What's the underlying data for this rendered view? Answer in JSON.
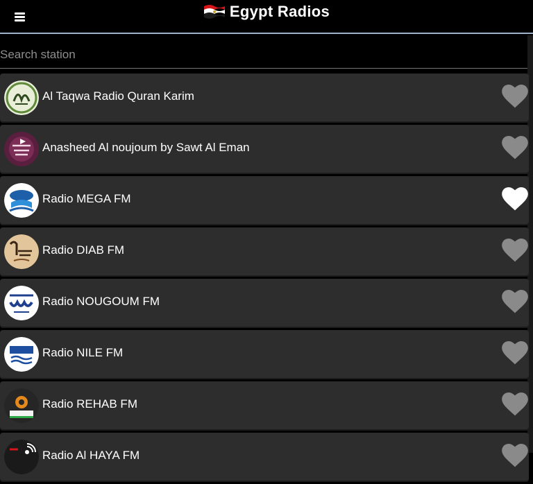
{
  "header": {
    "title": "Egypt Radios",
    "menu_icon": "hamburger-menu-icon",
    "flag_icon": "egypt-flag-icon"
  },
  "search": {
    "placeholder": "Search station",
    "value": ""
  },
  "colors": {
    "background": "#000000",
    "card": "#2d2d2d",
    "header_divider": "#9fb4cc",
    "heart_off": "#8a8a8a",
    "heart_on": "#ffffff"
  },
  "stations": [
    {
      "name": "Al Taqwa Radio Quran Karim",
      "favorite": false,
      "logo_icon": "quran-calligraphy-logo"
    },
    {
      "name": "Anasheed Al noujoum by Sawt Al Eman",
      "favorite": false,
      "logo_icon": "anasheed-logo"
    },
    {
      "name": "Radio MEGA FM",
      "favorite": true,
      "logo_icon": "mega-fm-logo"
    },
    {
      "name": "Radio DIAB FM",
      "favorite": false,
      "logo_icon": "diab-fm-logo"
    },
    {
      "name": "Radio NOUGOUM FM",
      "favorite": false,
      "logo_icon": "nougoum-fm-logo"
    },
    {
      "name": "Radio NILE FM",
      "favorite": false,
      "logo_icon": "nile-fm-logo"
    },
    {
      "name": "Radio REHAB FM",
      "favorite": false,
      "logo_icon": "rehab-fm-logo"
    },
    {
      "name": "Radio Al HAYA FM",
      "favorite": false,
      "logo_icon": "haya-fm-logo"
    }
  ]
}
